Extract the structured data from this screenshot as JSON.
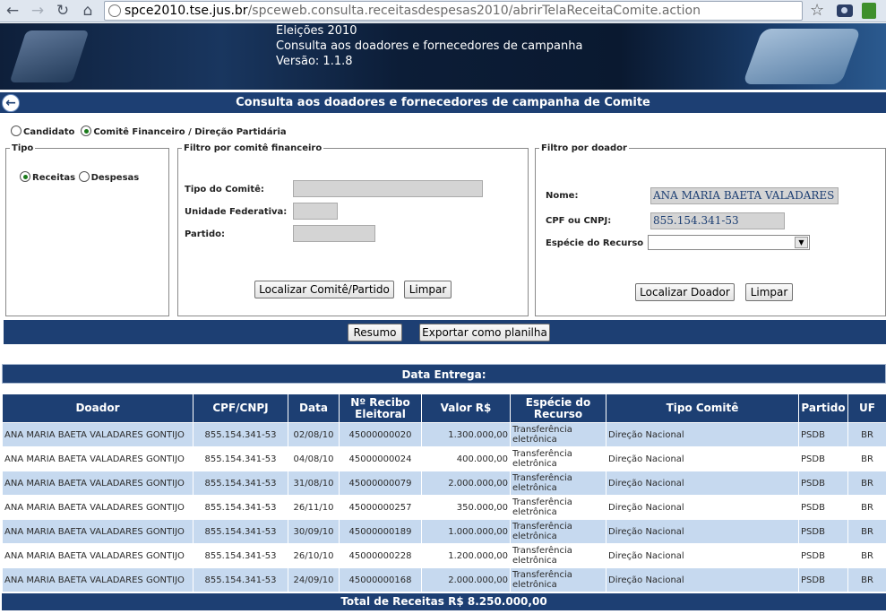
{
  "browser": {
    "url_host": "spce2010.tse.jus.br",
    "url_path": "/spceweb.consulta.receitasdespesas2010/abrirTelaReceitaComite.action"
  },
  "banner": {
    "line1": "Eleições 2010",
    "line2": "Consulta aos doadores e fornecedores de campanha",
    "line3": "Versão: 1.1.8"
  },
  "page_title": "Consulta aos doadores e fornecedores de campanha de Comite",
  "mode": {
    "candidato": "Candidato",
    "comite": "Comitê Financeiro / Direção Partidária",
    "selected": "comite"
  },
  "tipo": {
    "legend": "Tipo",
    "receitas": "Receitas",
    "despesas": "Despesas",
    "selected": "receitas"
  },
  "filtro_comite": {
    "legend": "Filtro por comitê financeiro",
    "tipo_label": "Tipo do Comitê:",
    "uf_label": "Unidade Federativa:",
    "partido_label": "Partido:",
    "localizar_button": "Localizar Comitê/Partido",
    "limpar_button": "Limpar"
  },
  "filtro_doador": {
    "legend": "Filtro por doador",
    "nome_label": "Nome:",
    "nome_value": "ANA MARIA BAETA VALADARES GON",
    "cpf_label": "CPF ou CNPJ:",
    "cpf_value": "855.154.341-53",
    "especie_label": "Espécie do Recurso",
    "especie_value": "",
    "localizar_button": "Localizar Doador",
    "limpar_button": "Limpar"
  },
  "actions": {
    "resumo": "Resumo",
    "exportar": "Exportar como planilha"
  },
  "data_entrega": "Data Entrega:",
  "table": {
    "headers": {
      "doador": "Doador",
      "cpf": "CPF/CNPJ",
      "data": "Data",
      "recibo": "Nº Recibo Eleitoral",
      "valor": "Valor R$",
      "especie": "Espécie do Recurso",
      "tipo_comite": "Tipo Comitê",
      "partido": "Partido",
      "uf": "UF"
    },
    "rows": [
      {
        "doador": "ANA MARIA BAETA VALADARES GONTIJO",
        "cpf": "855.154.341-53",
        "data": "02/08/10",
        "recibo": "45000000020",
        "valor": "1.300.000,00",
        "especie": "Transferência eletrônica",
        "tipo_comite": "Direção Nacional",
        "partido": "PSDB",
        "uf": "BR"
      },
      {
        "doador": "ANA MARIA BAETA VALADARES GONTIJO",
        "cpf": "855.154.341-53",
        "data": "04/08/10",
        "recibo": "45000000024",
        "valor": "400.000,00",
        "especie": "Transferência eletrônica",
        "tipo_comite": "Direção Nacional",
        "partido": "PSDB",
        "uf": "BR"
      },
      {
        "doador": "ANA MARIA BAETA VALADARES GONTIJO",
        "cpf": "855.154.341-53",
        "data": "31/08/10",
        "recibo": "45000000079",
        "valor": "2.000.000,00",
        "especie": "Transferência eletrônica",
        "tipo_comite": "Direção Nacional",
        "partido": "PSDB",
        "uf": "BR"
      },
      {
        "doador": "ANA MARIA BAETA VALADARES GONTIJO",
        "cpf": "855.154.341-53",
        "data": "26/11/10",
        "recibo": "45000000257",
        "valor": "350.000,00",
        "especie": "Transferência eletrônica",
        "tipo_comite": "Direção Nacional",
        "partido": "PSDB",
        "uf": "BR"
      },
      {
        "doador": "ANA MARIA BAETA VALADARES GONTIJO",
        "cpf": "855.154.341-53",
        "data": "30/09/10",
        "recibo": "45000000189",
        "valor": "1.000.000,00",
        "especie": "Transferência eletrônica",
        "tipo_comite": "Direção Nacional",
        "partido": "PSDB",
        "uf": "BR"
      },
      {
        "doador": "ANA MARIA BAETA VALADARES GONTIJO",
        "cpf": "855.154.341-53",
        "data": "26/10/10",
        "recibo": "45000000228",
        "valor": "1.200.000,00",
        "especie": "Transferência eletrônica",
        "tipo_comite": "Direção Nacional",
        "partido": "PSDB",
        "uf": "BR"
      },
      {
        "doador": "ANA MARIA BAETA VALADARES GONTIJO",
        "cpf": "855.154.341-53",
        "data": "24/09/10",
        "recibo": "45000000168",
        "valor": "2.000.000,00",
        "especie": "Transferência eletrônica",
        "tipo_comite": "Direção Nacional",
        "partido": "PSDB",
        "uf": "BR"
      }
    ]
  },
  "total": "Total de Receitas R$ 8.250.000,00",
  "colors": {
    "primary": "#1d3f73",
    "row_alt": "#c6d9ef"
  }
}
